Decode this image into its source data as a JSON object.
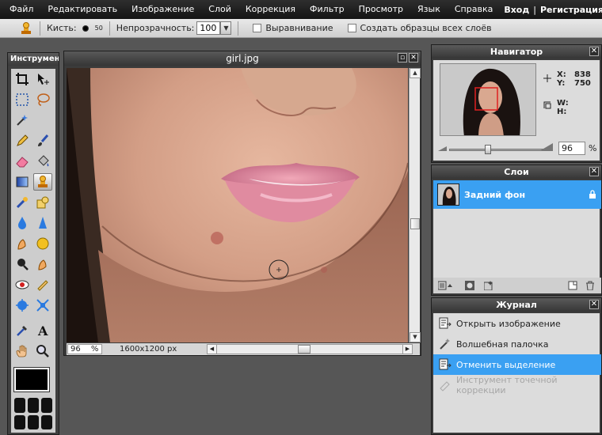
{
  "menu": {
    "items": [
      "Файл",
      "Редактировать",
      "Изображение",
      "Слой",
      "Коррекция",
      "Фильтр",
      "Просмотр",
      "Язык",
      "Справка"
    ],
    "login": "Вход",
    "separator": "|",
    "register": "Регистрация"
  },
  "options": {
    "brush_label": "Кисть:",
    "brush_size": "50",
    "opacity_label": "Непрозрачность:",
    "opacity_value": "100",
    "align_label": "Выравнивание",
    "sample_all_label": "Создать образцы всех слоёв"
  },
  "toolbox": {
    "title": "Инструменты"
  },
  "image_window": {
    "title": "girl.jpg",
    "zoom": "96",
    "zoom_unit": "%",
    "dimensions": "1600x1200 px"
  },
  "navigator": {
    "title": "Навигатор",
    "x_label": "X:",
    "x_value": "838",
    "y_label": "Y:",
    "y_value": "750",
    "w_label": "W:",
    "h_label": "H:",
    "zoom": "96",
    "zoom_unit": "%"
  },
  "layers": {
    "title": "Слои",
    "items": [
      {
        "name": "Задний фон",
        "locked": true
      }
    ]
  },
  "history": {
    "title": "Журнал",
    "items": [
      {
        "label": "Открыть изображение",
        "icon": "document-arrow-icon",
        "state": "normal"
      },
      {
        "label": "Волшебная палочка",
        "icon": "magic-wand-icon",
        "state": "normal"
      },
      {
        "label": "Отменить выделение",
        "icon": "document-arrow-icon",
        "state": "selected"
      },
      {
        "label": "Инструмент точечной коррекции",
        "icon": "spot-healing-icon",
        "state": "dimmed"
      }
    ]
  },
  "colors": {
    "accent": "#3aa0f2",
    "foreground_swatch": "#000000"
  }
}
